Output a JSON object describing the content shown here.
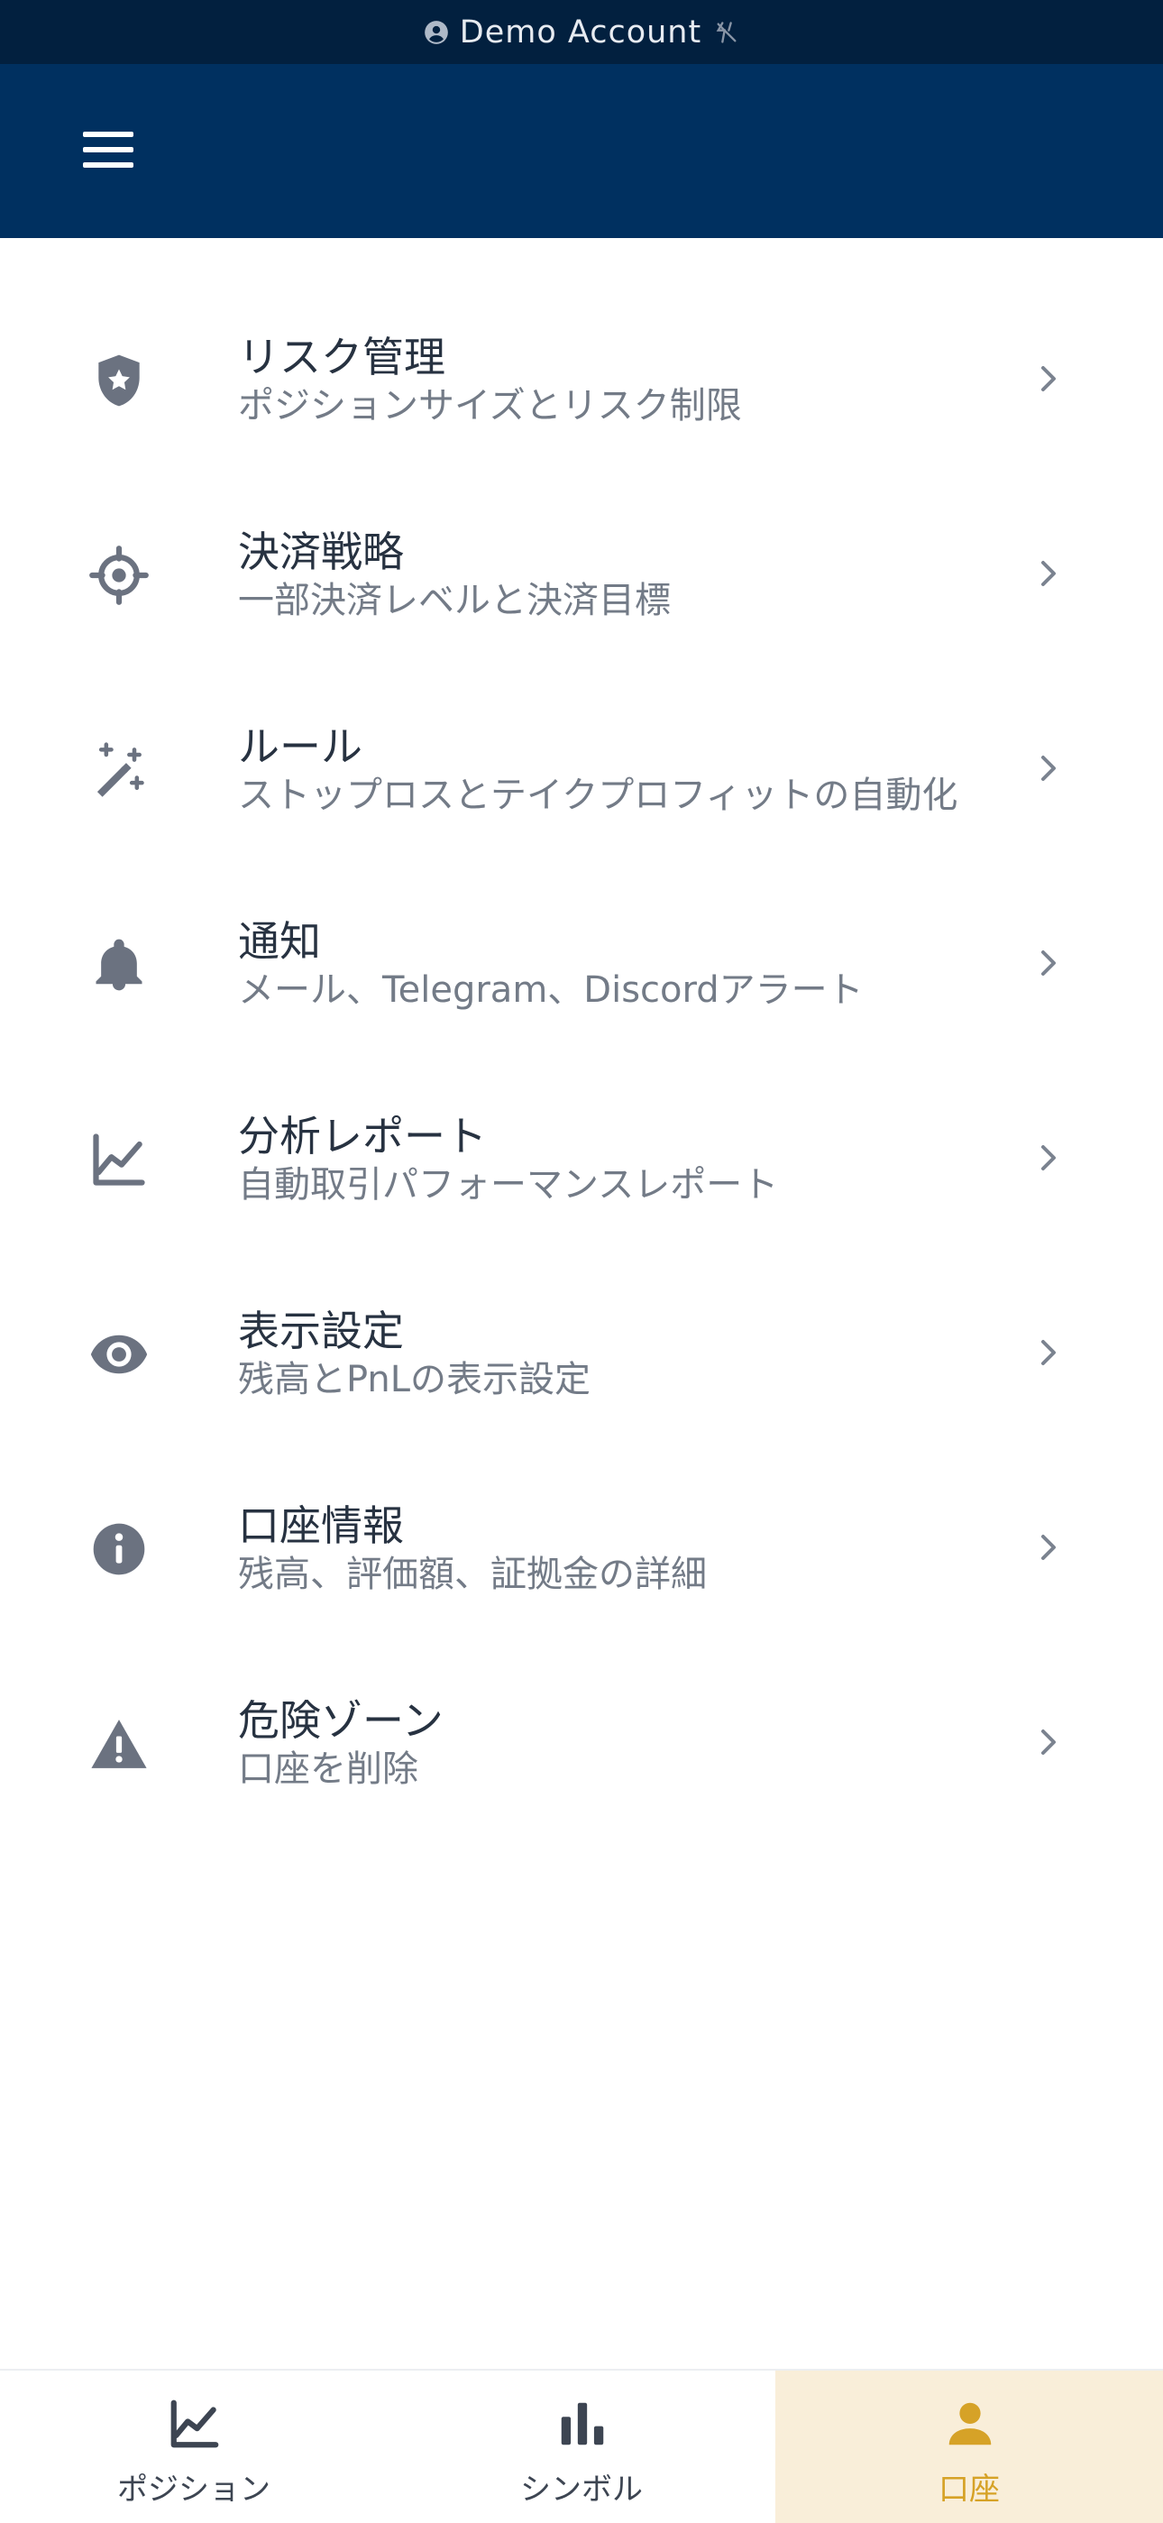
{
  "status_bar": {
    "account_label": "Demo Account",
    "account_icon": "account-circle-icon",
    "sync_icon": "sync-disabled-icon"
  },
  "header": {
    "menu_icon": "hamburger-menu-icon"
  },
  "settings": {
    "items": [
      {
        "key": "risk",
        "icon": "shield-star-icon",
        "title": "リスク管理",
        "subtitle": "ポジションサイズとリスク制限"
      },
      {
        "key": "exit",
        "icon": "crosshair-icon",
        "title": "決済戦略",
        "subtitle": "一部決済レベルと決済目標"
      },
      {
        "key": "rules",
        "icon": "magic-wand-icon",
        "title": "ルール",
        "subtitle": "ストップロスとテイクプロフィットの自動化"
      },
      {
        "key": "notifications",
        "icon": "bell-icon",
        "title": "通知",
        "subtitle": "メール、Telegram、Discordアラート"
      },
      {
        "key": "analytics",
        "icon": "line-chart-icon",
        "title": "分析レポート",
        "subtitle": "自動取引パフォーマンスレポート"
      },
      {
        "key": "display",
        "icon": "eye-icon",
        "title": "表示設定",
        "subtitle": "残高とPnLの表示設定"
      },
      {
        "key": "account-info",
        "icon": "info-icon",
        "title": "口座情報",
        "subtitle": "残高、評価額、証拠金の詳細"
      },
      {
        "key": "danger",
        "icon": "warning-icon",
        "title": "危険ゾーン",
        "subtitle": "口座を削除"
      }
    ]
  },
  "bottom_nav": {
    "tabs": [
      {
        "label": "ポジション",
        "icon": "line-chart-icon",
        "active": false
      },
      {
        "label": "シンボル",
        "icon": "bar-chart-icon",
        "active": false
      },
      {
        "label": "口座",
        "icon": "person-icon",
        "active": true
      }
    ]
  },
  "colors": {
    "status_bar_bg": "#02203f",
    "header_bg": "#003060",
    "icon_gray": "#6b7280",
    "title_text": "#273241",
    "subtitle_text": "#737b87",
    "active_tab_bg": "#f9eed9",
    "active_tab_accent": "#d6a227"
  }
}
